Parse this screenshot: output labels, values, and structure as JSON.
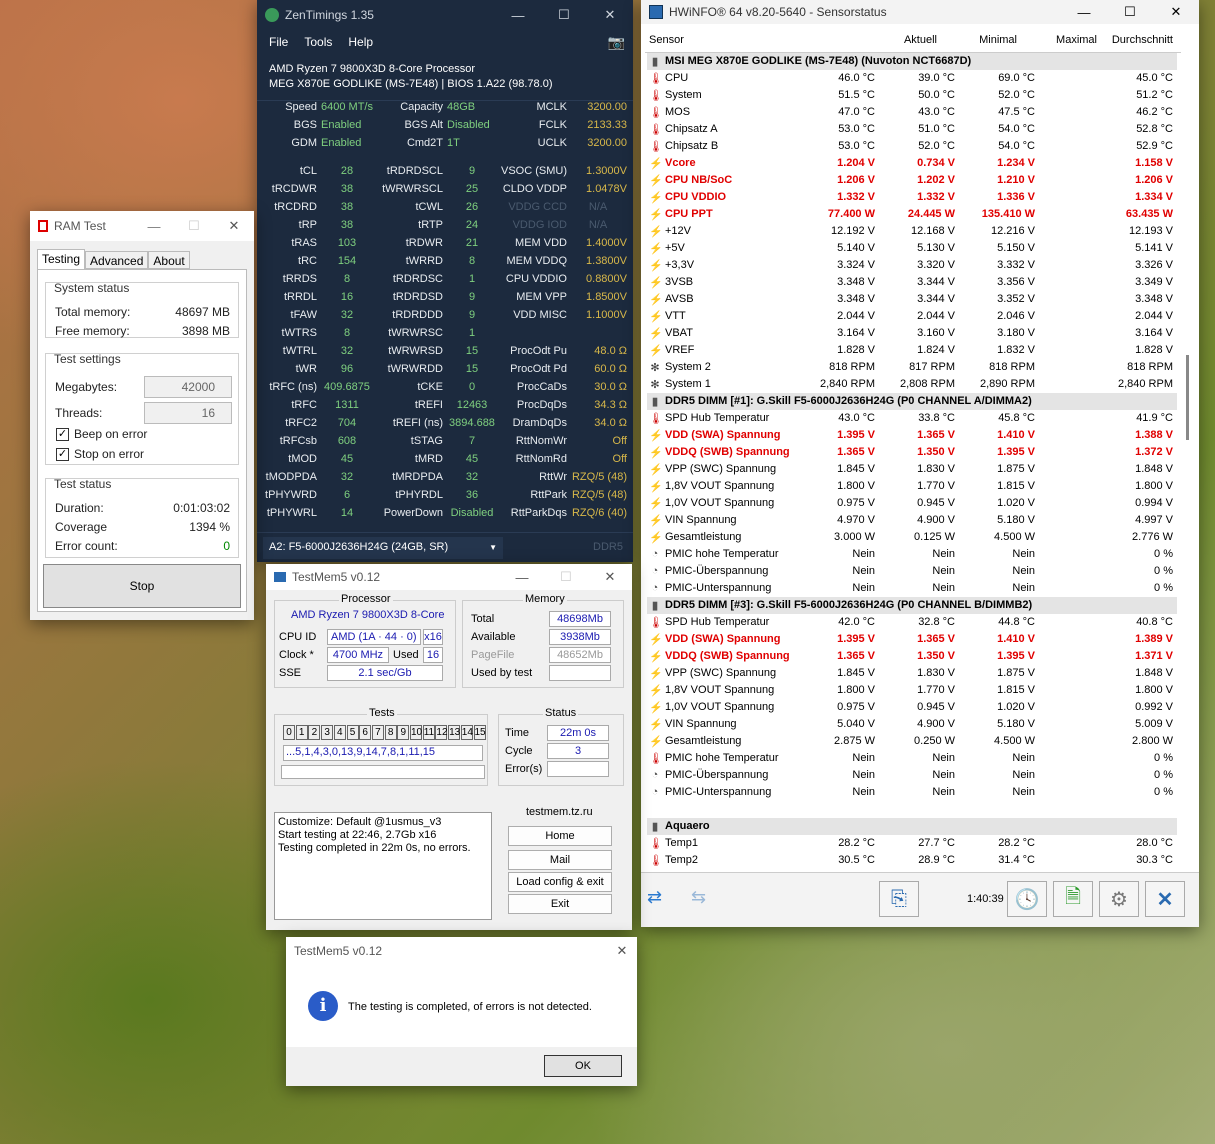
{
  "zen": {
    "title": "ZenTimings 1.35",
    "menu": [
      "File",
      "Tools",
      "Help"
    ],
    "cpu": "AMD Ryzen 7 9800X3D 8-Core Processor",
    "board": "MEG X870E GODLIKE (MS-7E48) | BIOS 1.A22 (98.78.0)",
    "info": [
      [
        "Speed",
        "6400 MT/s",
        "Capacity",
        "48GB",
        "MCLK",
        "3200.00"
      ],
      [
        "BGS",
        "Enabled",
        "BGS Alt",
        "Disabled",
        "FCLK",
        "2133.33"
      ],
      [
        "GDM",
        "Enabled",
        "Cmd2T",
        "1T",
        "UCLK",
        "3200.00"
      ]
    ],
    "timings": [
      [
        "tCL",
        "28",
        "tRDRDSCL",
        "9",
        "VSOC (SMU)",
        "1.3000V"
      ],
      [
        "tRCDWR",
        "38",
        "tWRWRSCL",
        "25",
        "CLDO VDDP",
        "1.0478V"
      ],
      [
        "tRCDRD",
        "38",
        "tCWL",
        "26",
        "VDDG CCD",
        "N/A"
      ],
      [
        "tRP",
        "38",
        "tRTP",
        "24",
        "VDDG IOD",
        "N/A"
      ],
      [
        "tRAS",
        "103",
        "tRDWR",
        "21",
        "MEM VDD",
        "1.4000V"
      ],
      [
        "tRC",
        "154",
        "tWRRD",
        "8",
        "MEM VDDQ",
        "1.3800V"
      ],
      [
        "tRRDS",
        "8",
        "tRDRDSC",
        "1",
        "CPU VDDIO",
        "0.8800V"
      ],
      [
        "tRRDL",
        "16",
        "tRDRDSD",
        "9",
        "MEM VPP",
        "1.8500V"
      ],
      [
        "tFAW",
        "32",
        "tRDRDDD",
        "9",
        "VDD MISC",
        "1.1000V"
      ],
      [
        "tWTRS",
        "8",
        "tWRWRSC",
        "1",
        "",
        ""
      ],
      [
        "tWTRL",
        "32",
        "tWRWRSD",
        "15",
        "ProcOdt Pu",
        "48.0 Ω"
      ],
      [
        "tWR",
        "96",
        "tWRWRDD",
        "15",
        "ProcOdt Pd",
        "60.0 Ω"
      ],
      [
        "tRFC (ns)",
        "409.6875",
        "tCKE",
        "0",
        "ProcCaDs",
        "30.0 Ω"
      ],
      [
        "tRFC",
        "1311",
        "tREFI",
        "12463",
        "ProcDqDs",
        "34.3 Ω"
      ],
      [
        "tRFC2",
        "704",
        "tREFI (ns)",
        "3894.688",
        "DramDqDs",
        "34.0 Ω"
      ],
      [
        "tRFCsb",
        "608",
        "tSTAG",
        "7",
        "RttNomWr",
        "Off"
      ],
      [
        "tMOD",
        "45",
        "tMRD",
        "45",
        "RttNomRd",
        "Off"
      ],
      [
        "tMODPDA",
        "32",
        "tMRDPDA",
        "32",
        "RttWr",
        "RZQ/5 (48)"
      ],
      [
        "tPHYWRD",
        "6",
        "tPHYRDL",
        "36",
        "RttPark",
        "RZQ/5 (48)"
      ],
      [
        "tPHYWRL",
        "14",
        "PowerDown",
        "Disabled",
        "RttParkDqs",
        "RZQ/6 (40)"
      ]
    ],
    "dimm": "A2: F5-6000J2636H24G (24GB, SR)",
    "ddr": "DDR5"
  },
  "ramtest": {
    "title": "RAM Test",
    "tabs": [
      "Testing",
      "Advanced",
      "About"
    ],
    "sys_status": "System status",
    "total_label": "Total memory:",
    "total": "48697 MB",
    "free_label": "Free memory:",
    "free": "3898 MB",
    "settings": "Test settings",
    "mb_label": "Megabytes:",
    "mb": "42000",
    "thr_label": "Threads:",
    "thr": "16",
    "beep": "Beep on error",
    "stop_err": "Stop on error",
    "status": "Test status",
    "dur_label": "Duration:",
    "dur": "0:01:03:02",
    "cov_label": "Coverage",
    "cov": "1394 %",
    "err_label": "Error count:",
    "err": "0",
    "stop": "Stop"
  },
  "hw": {
    "title": "HWiNFO® 64 v8.20-5640 - Sensorstatus",
    "cols": [
      "Sensor",
      "Aktuell",
      "Minimal",
      "Maximal",
      "Durchschnitt"
    ],
    "rows": [
      {
        "g": 1,
        "n": "MSI MEG X870E GODLIKE (MS-7E48) (Nuvoton NCT6687D)"
      },
      {
        "i": "t",
        "n": "CPU",
        "v": [
          "46.0 °C",
          "39.0 °C",
          "69.0 °C",
          "45.0 °C"
        ]
      },
      {
        "i": "t",
        "n": "System",
        "v": [
          "51.5 °C",
          "50.0 °C",
          "52.0 °C",
          "51.2 °C"
        ]
      },
      {
        "i": "t",
        "n": "MOS",
        "v": [
          "47.0 °C",
          "43.0 °C",
          "47.5 °C",
          "46.2 °C"
        ]
      },
      {
        "i": "t",
        "n": "Chipsatz A",
        "v": [
          "53.0 °C",
          "51.0 °C",
          "54.0 °C",
          "52.8 °C"
        ]
      },
      {
        "i": "t",
        "n": "Chipsatz B",
        "v": [
          "53.0 °C",
          "52.0 °C",
          "54.0 °C",
          "52.9 °C"
        ]
      },
      {
        "i": "v",
        "r": 1,
        "n": "Vcore",
        "v": [
          "1.204 V",
          "0.734 V",
          "1.234 V",
          "1.158 V"
        ]
      },
      {
        "i": "v",
        "r": 1,
        "n": "CPU NB/SoC",
        "v": [
          "1.206 V",
          "1.202 V",
          "1.210 V",
          "1.206 V"
        ]
      },
      {
        "i": "v",
        "r": 1,
        "n": "CPU VDDIO",
        "v": [
          "1.332 V",
          "1.332 V",
          "1.336 V",
          "1.334 V"
        ]
      },
      {
        "i": "v",
        "r": 1,
        "n": "CPU PPT",
        "v": [
          "77.400 W",
          "24.445 W",
          "135.410 W",
          "63.435 W"
        ]
      },
      {
        "i": "v",
        "n": "+12V",
        "v": [
          "12.192 V",
          "12.168 V",
          "12.216 V",
          "12.193 V"
        ]
      },
      {
        "i": "v",
        "n": "+5V",
        "v": [
          "5.140 V",
          "5.130 V",
          "5.150 V",
          "5.141 V"
        ]
      },
      {
        "i": "v",
        "n": "+3,3V",
        "v": [
          "3.324 V",
          "3.320 V",
          "3.332 V",
          "3.326 V"
        ]
      },
      {
        "i": "v",
        "n": "3VSB",
        "v": [
          "3.348 V",
          "3.344 V",
          "3.356 V",
          "3.349 V"
        ]
      },
      {
        "i": "v",
        "n": "AVSB",
        "v": [
          "3.348 V",
          "3.344 V",
          "3.352 V",
          "3.348 V"
        ]
      },
      {
        "i": "v",
        "n": "VTT",
        "v": [
          "2.044 V",
          "2.044 V",
          "2.046 V",
          "2.044 V"
        ]
      },
      {
        "i": "v",
        "n": "VBAT",
        "v": [
          "3.164 V",
          "3.160 V",
          "3.180 V",
          "3.164 V"
        ]
      },
      {
        "i": "v",
        "n": "VREF",
        "v": [
          "1.828 V",
          "1.824 V",
          "1.832 V",
          "1.828 V"
        ]
      },
      {
        "i": "f",
        "n": "System 2",
        "v": [
          "818 RPM",
          "817 RPM",
          "818 RPM",
          "818 RPM"
        ]
      },
      {
        "i": "f",
        "n": "System 1",
        "v": [
          "2,840 RPM",
          "2,808 RPM",
          "2,890 RPM",
          "2,840 RPM"
        ]
      },
      {
        "g": 1,
        "n": "DDR5 DIMM [#1]: G.Skill F5-6000J2636H24G (P0 CHANNEL A/DIMMA2)"
      },
      {
        "i": "t",
        "n": "SPD Hub Temperatur",
        "v": [
          "43.0 °C",
          "33.8 °C",
          "45.8 °C",
          "41.9 °C"
        ]
      },
      {
        "i": "v",
        "r": 1,
        "n": "VDD (SWA) Spannung",
        "v": [
          "1.395 V",
          "1.365 V",
          "1.410 V",
          "1.388 V"
        ]
      },
      {
        "i": "v",
        "r": 1,
        "n": "VDDQ (SWB) Spannung",
        "v": [
          "1.365 V",
          "1.350 V",
          "1.395 V",
          "1.372 V"
        ]
      },
      {
        "i": "v",
        "n": "VPP (SWC) Spannung",
        "v": [
          "1.845 V",
          "1.830 V",
          "1.875 V",
          "1.848 V"
        ]
      },
      {
        "i": "v",
        "n": "1,8V VOUT Spannung",
        "v": [
          "1.800 V",
          "1.770 V",
          "1.815 V",
          "1.800 V"
        ]
      },
      {
        "i": "v",
        "n": "1,0V VOUT Spannung",
        "v": [
          "0.975 V",
          "0.945 V",
          "1.020 V",
          "0.994 V"
        ]
      },
      {
        "i": "v",
        "n": "VIN Spannung",
        "v": [
          "4.970 V",
          "4.900 V",
          "5.180 V",
          "4.997 V"
        ]
      },
      {
        "i": "v",
        "n": "Gesamtleistung",
        "v": [
          "3.000 W",
          "0.125 W",
          "4.500 W",
          "2.776 W"
        ]
      },
      {
        "i": "c",
        "n": "PMIC hohe Temperatur",
        "v": [
          "Nein",
          "Nein",
          "Nein",
          "0 %"
        ]
      },
      {
        "i": "c",
        "n": "PMIC-Überspannung",
        "v": [
          "Nein",
          "Nein",
          "Nein",
          "0 %"
        ]
      },
      {
        "i": "c",
        "n": "PMIC-Unterspannung",
        "v": [
          "Nein",
          "Nein",
          "Nein",
          "0 %"
        ]
      },
      {
        "g": 1,
        "n": "DDR5 DIMM [#3]: G.Skill F5-6000J2636H24G (P0 CHANNEL B/DIMMB2)"
      },
      {
        "i": "t",
        "n": "SPD Hub Temperatur",
        "v": [
          "42.0 °C",
          "32.8 °C",
          "44.8 °C",
          "40.8 °C"
        ]
      },
      {
        "i": "v",
        "r": 1,
        "n": "VDD (SWA) Spannung",
        "v": [
          "1.395 V",
          "1.365 V",
          "1.410 V",
          "1.389 V"
        ]
      },
      {
        "i": "v",
        "r": 1,
        "n": "VDDQ (SWB) Spannung",
        "v": [
          "1.365 V",
          "1.350 V",
          "1.395 V",
          "1.371 V"
        ]
      },
      {
        "i": "v",
        "n": "VPP (SWC) Spannung",
        "v": [
          "1.845 V",
          "1.830 V",
          "1.875 V",
          "1.848 V"
        ]
      },
      {
        "i": "v",
        "n": "1,8V VOUT Spannung",
        "v": [
          "1.800 V",
          "1.770 V",
          "1.815 V",
          "1.800 V"
        ]
      },
      {
        "i": "v",
        "n": "1,0V VOUT Spannung",
        "v": [
          "0.975 V",
          "0.945 V",
          "1.020 V",
          "0.992 V"
        ]
      },
      {
        "i": "v",
        "n": "VIN Spannung",
        "v": [
          "5.040 V",
          "4.900 V",
          "5.180 V",
          "5.009 V"
        ]
      },
      {
        "i": "v",
        "n": "Gesamtleistung",
        "v": [
          "2.875 W",
          "0.250 W",
          "4.500 W",
          "2.800 W"
        ]
      },
      {
        "i": "t",
        "n": "PMIC hohe Temperatur",
        "v": [
          "Nein",
          "Nein",
          "Nein",
          "0 %"
        ]
      },
      {
        "i": "c",
        "n": "PMIC-Überspannung",
        "v": [
          "Nein",
          "Nein",
          "Nein",
          "0 %"
        ]
      },
      {
        "i": "c",
        "n": "PMIC-Unterspannung",
        "v": [
          "Nein",
          "Nein",
          "Nein",
          "0 %"
        ]
      },
      {
        "blank": 1
      },
      {
        "g": 1,
        "n": "Aquaero"
      },
      {
        "i": "t",
        "n": "Temp1",
        "v": [
          "28.2 °C",
          "27.7 °C",
          "28.2 °C",
          "28.0 °C"
        ]
      },
      {
        "i": "t",
        "n": "Temp2",
        "v": [
          "30.5 °C",
          "28.9 °C",
          "31.4 °C",
          "30.3 °C"
        ]
      }
    ],
    "time": "1:40:39"
  },
  "tm": {
    "title": "TestMem5 v0.12",
    "proc": "Processor",
    "cpu": "AMD Ryzen 7 9800X3D 8-Core",
    "cpuid_l": "CPU ID",
    "cpuid": "AMD  (1A · 44 · 0)",
    "x16": "x16",
    "clock_l": "Clock *",
    "clock": "4700 MHz",
    "used_l": "Used",
    "used": "16",
    "sse_l": "SSE",
    "sse": "2.1 sec/Gb",
    "mem": "Memory",
    "total_l": "Total",
    "total": "48698Mb",
    "avail_l": "Available",
    "avail": "3938Mb",
    "pf_l": "PageFile",
    "pf": "48652Mb",
    "ubt_l": "Used by test",
    "tests": "Tests",
    "cells": [
      "0",
      "1",
      "2",
      "3",
      "4",
      "5",
      "6",
      "7",
      "8",
      "9",
      "10",
      "11",
      "12",
      "13",
      "14",
      "15"
    ],
    "seq": "...5,1,4,3,0,13,9,14,7,8,1,11,15",
    "status": "Status",
    "time_l": "Time",
    "time": "22m 0s",
    "cycle_l": "Cycle",
    "cycle": "3",
    "err_l": "Error(s)",
    "log": [
      "Customize: Default @1usmus_v3",
      "Start testing at 22:46, 2.7Gb x16",
      "Testing completed in 22m 0s, no errors."
    ],
    "site": "testmem.tz.ru",
    "btns": [
      "Home",
      "Mail",
      "Load config & exit",
      "Exit"
    ]
  },
  "dlg": {
    "title": "TestMem5 v0.12",
    "msg": "The testing is completed, of errors is not detected.",
    "ok": "OK"
  }
}
